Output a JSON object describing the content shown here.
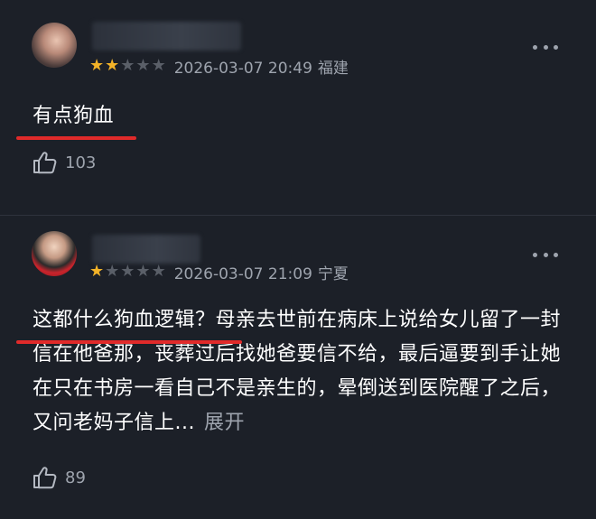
{
  "reviews": [
    {
      "rating": 2,
      "max_rating": 5,
      "date": "2026-03-07 20:49",
      "location": "福建",
      "content": "有点狗血",
      "expand_label": "",
      "likes": "103"
    },
    {
      "rating": 1,
      "max_rating": 5,
      "date": "2026-03-07 21:09",
      "location": "宁夏",
      "content": "这都什么狗血逻辑？母亲去世前在病床上说给女儿留了一封信在他爸那，丧葬过后找她爸要信不给，最后逼要到手让她在只在书房一看自己不是亲生的，晕倒送到医院醒了之后，又问老妈子信上...",
      "expand_label": "展开",
      "likes": "89"
    }
  ],
  "colors": {
    "background": "#1c2028",
    "star_on": "#f3b328",
    "star_off": "#5a5f68",
    "highlight_underline": "#e02a2a",
    "meta_text": "#9ea4ae"
  },
  "icons": {
    "more": "more-dots-icon",
    "like": "thumbs-up-icon"
  }
}
